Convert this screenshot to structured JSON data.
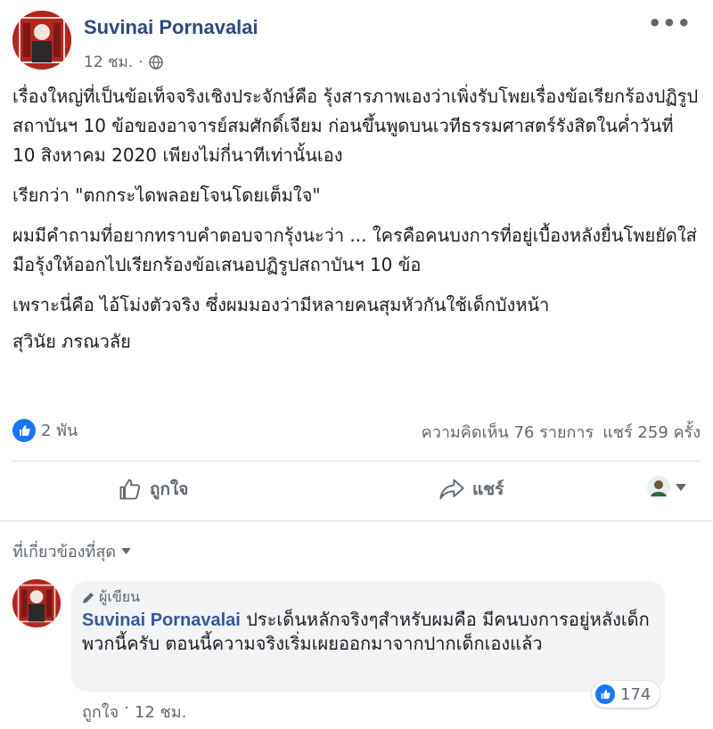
{
  "post": {
    "author": "Suvinai Pornavalai",
    "time": "12 ชม.",
    "dot": "·",
    "more": "•••",
    "paragraphs": [
      "เรื่องใหญ่ที่เป็นข้อเท็จจริงเชิงประจักษ์คือ รุ้งสารภาพเองว่าเพิ่งรับโพยเรื่องข้อเรียกร้องปฏิรูปสถาบันฯ 10 ข้อของอาจารย์สมศักดิ์เจียม ก่อนขึ้นพูดบนเวทีธรรมศาสตร์รังสิตในค่ำวันที่ 10 สิงหาคม 2020 เพียงไม่กี่นาทีเท่านั้นเอง",
      "เรียกว่า \"ตกกระไดพลอยโจนโดยเต็มใจ\"",
      "ผมมีคำถามที่อยากทราบคำตอบจากรุ้งนะว่า ... ใครคือคนบงการที่อยู่เบื้องหลังยื่นโพยยัดใส่มือรุ้งให้ออกไปเรียกร้องข้อเสนอปฏิรูปสถาบันฯ 10 ข้อ",
      "เพราะนี่คือ ไอ้โม่งตัวจริง ซึ่งผมมองว่ามีหลายคนสุมหัวกันใช้เด็กบังหน้า",
      "สุวินัย ภรณวลัย"
    ]
  },
  "stats": {
    "likes": "2 พัน",
    "comments": "ความคิดเห็น 76 รายการ",
    "shares": "แชร์ 259 ครั้ง"
  },
  "actions": {
    "like": "ถูกใจ",
    "share": "แชร์"
  },
  "filter": {
    "label": "ที่เกี่ยวข้องที่สุด"
  },
  "comment": {
    "badge": "ผู้เขียน",
    "author": "Suvinai Pornavalai",
    "text": "ประเด็นหลักจริงๆสำหรับผมคือ มีคนบงการอยู่หลังเด็กพวกนี้ครับ ตอนนี้ความจริงเริ่มเผยออกมาจากปากเด็กเองแล้ว",
    "reactions": "174",
    "like_label": "ถูกใจ",
    "dot": "·",
    "time": "12 ชม."
  },
  "colors": {
    "name_blue": "#2f4a7f",
    "link_blue": "#365899",
    "fb_blue": "#1877f2",
    "avatar_red": "#b3261e",
    "meta_gray": "#606770"
  }
}
